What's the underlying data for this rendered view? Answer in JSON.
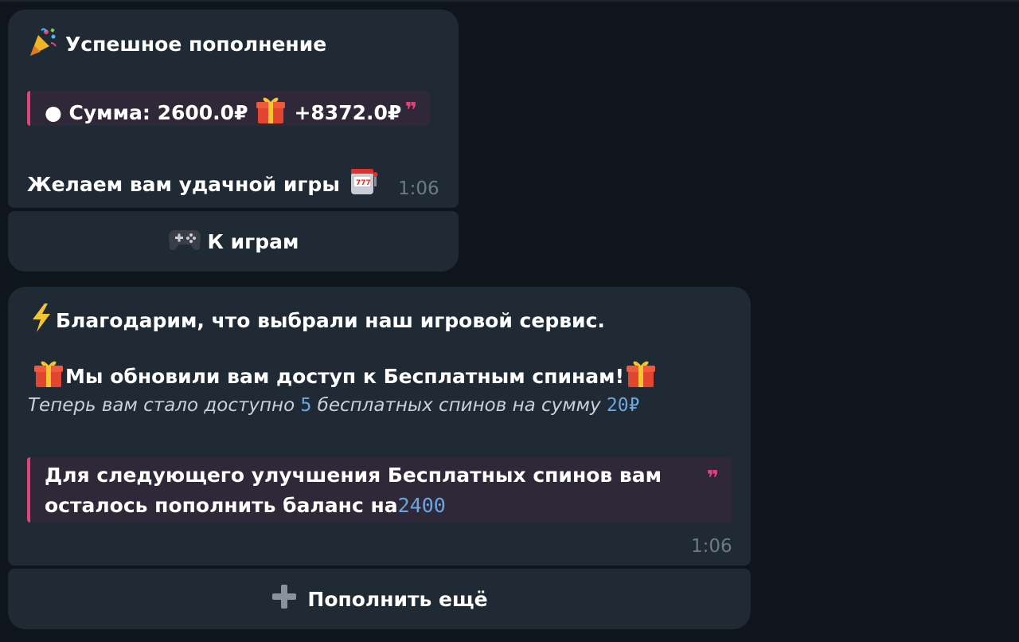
{
  "msg1": {
    "title": "Успешное пополнение",
    "sum_text": "● Сумма: 2600.0₽",
    "bonus_text": "+8372.0₽",
    "wish_text": "Желаем вам удачной игры",
    "time": "1:06"
  },
  "btn1": {
    "label": "К играм"
  },
  "msg2": {
    "line1": "Благодарим, что выбрали наш игровой сервис.",
    "line2": "Мы обновили вам доступ к Бесплатным спинам!",
    "italic_a": "Теперь вам стало доступно ",
    "spins": "5",
    "italic_b": " бесплатных спинов на сумму ",
    "amount": "20₽",
    "quote_line1": "Для следующего улучшения Бесплатных спинов вам",
    "quote_line2": "осталось пополнить баланс на ",
    "remaining": "2400",
    "time": "1:06"
  },
  "btn2": {
    "label": "Пополнить ещё"
  },
  "icons": [
    "party-popper-icon",
    "gift-icon",
    "slot-machine-icon",
    "gamepad-icon",
    "lightning-icon",
    "plus-icon",
    "quote-icon"
  ],
  "colors": {
    "accent": "#e0457a",
    "link": "#6aa7e0",
    "bubble": "#1f2a35",
    "background": "#0f151c"
  }
}
